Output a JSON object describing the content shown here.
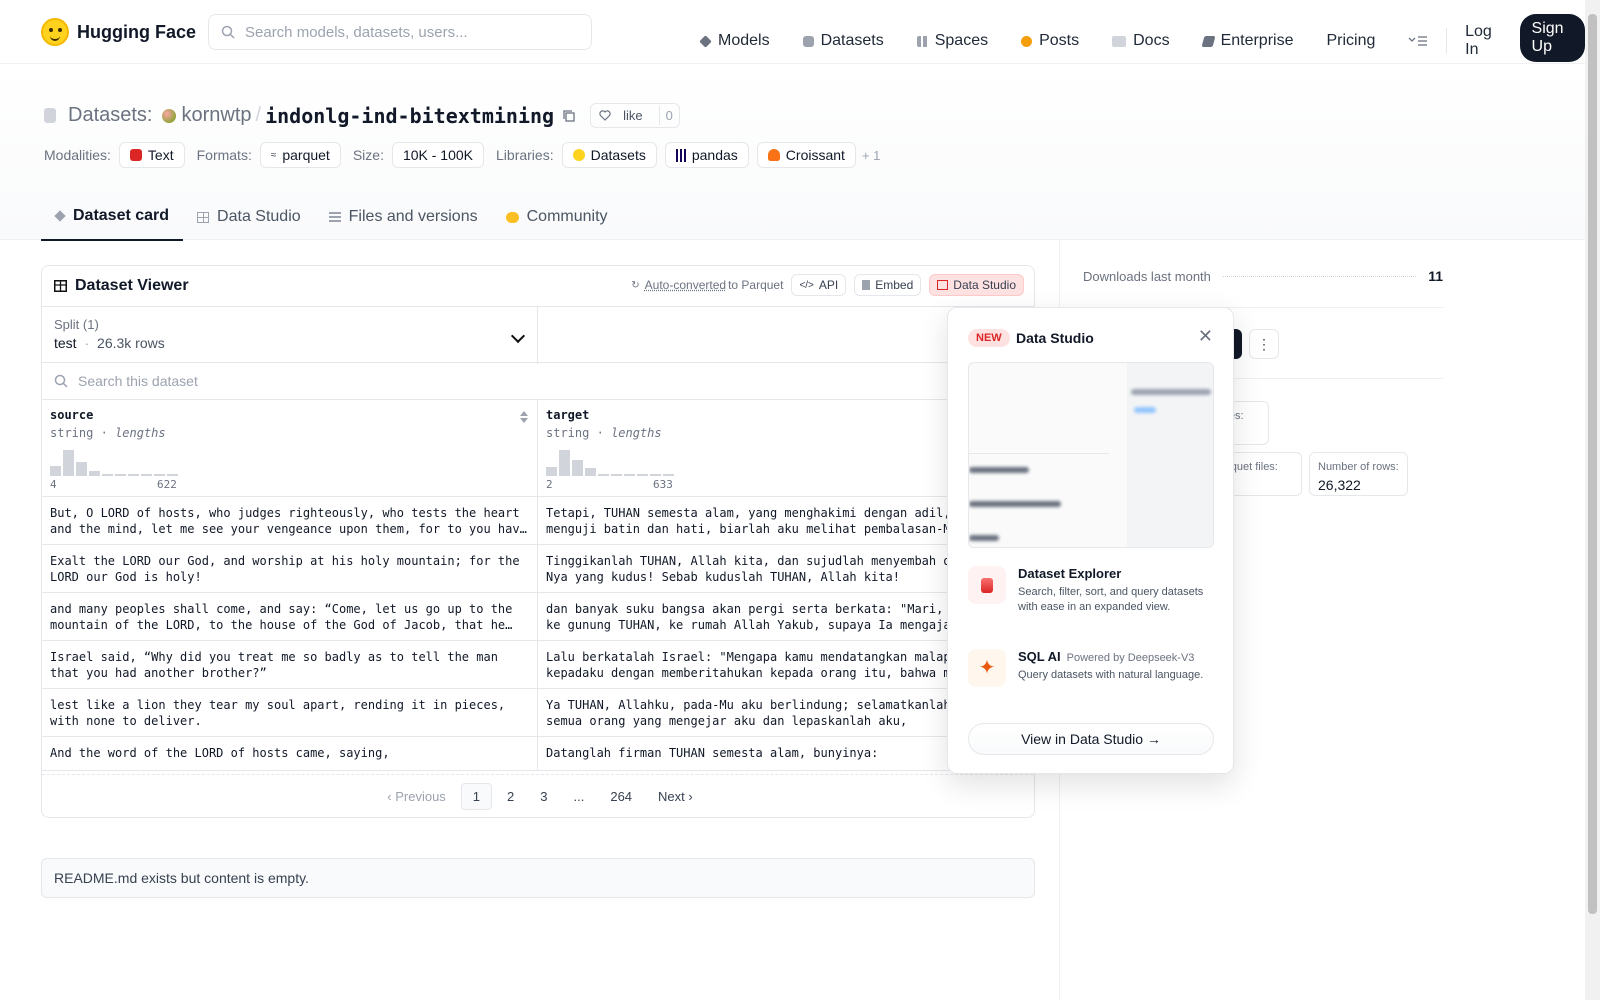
{
  "header": {
    "logo_text": "Hugging Face",
    "search_placeholder": "Search models, datasets, users...",
    "nav": [
      {
        "label": "Models",
        "icon": "cube-icon",
        "color": "#6b7280"
      },
      {
        "label": "Datasets",
        "icon": "database-icon",
        "color": "#9ca3af"
      },
      {
        "label": "Spaces",
        "icon": "grid-icon",
        "color": "#9ca3af"
      },
      {
        "label": "Posts",
        "icon": "chat-icon",
        "color": "#f59e0b"
      },
      {
        "label": "Docs",
        "icon": "book-icon",
        "color": "#9ca3af"
      },
      {
        "label": "Enterprise",
        "icon": "enterprise-icon",
        "color": "#6b7280"
      },
      {
        "label": "Pricing",
        "icon": "",
        "color": ""
      }
    ],
    "login": "Log In",
    "signup": "Sign Up"
  },
  "dataset": {
    "prefix": "Datasets:",
    "owner": "kornwtp",
    "slash": "/",
    "name": "indonlg-ind-bitextmining",
    "like_label": "like",
    "like_count": "0",
    "modalities_label": "Modalities:",
    "modality": "Text",
    "formats_label": "Formats:",
    "format": "parquet",
    "size_label": "Size:",
    "size": "10K - 100K",
    "libraries_label": "Libraries:",
    "libraries": [
      "Datasets",
      "pandas",
      "Croissant"
    ],
    "more_libs": "+ 1"
  },
  "tabs": [
    "Dataset card",
    "Data Studio",
    "Files and versions",
    "Community"
  ],
  "viewer": {
    "title": "Dataset Viewer",
    "auto_converted": "Auto-converted",
    "to_parquet": "to Parquet",
    "api": "API",
    "embed": "Embed",
    "data_studio": "Data Studio",
    "split_label": "Split (1)",
    "split_value": "test",
    "split_dot": "·",
    "split_rows": "26.3k rows",
    "search_placeholder": "Search this dataset",
    "columns": [
      {
        "name": "source",
        "type": "string",
        "dot": "·",
        "sub": "lengths",
        "min": "4",
        "max": "622",
        "hist": [
          0.4,
          1.0,
          0.55,
          0.2,
          0.05,
          0.05,
          0.05,
          0.05,
          0.05,
          0.05
        ]
      },
      {
        "name": "target",
        "type": "string",
        "dot": "·",
        "sub": "lengths",
        "min": "2",
        "max": "633",
        "hist": [
          0.35,
          1.0,
          0.6,
          0.3,
          0.08,
          0.05,
          0.05,
          0.05,
          0.05,
          0.05
        ]
      }
    ],
    "rows": [
      [
        "But, O LORD of hosts, who judges righteously, who tests the heart and the mind, let me see your vengeance upon them, for to you have I committed my cause.",
        "Tetapi, TUHAN semesta alam, yang menghakimi dengan adil, yang menguji batin dan hati, biarlah aku melihat pembalasan-Mu terhadap mereka"
      ],
      [
        "Exalt the LORD our God, and worship at his holy mountain; for the LORD our God is holy!",
        "Tinggikanlah TUHAN, Allah kita, dan sujudlah menyembah di gunung-Nya yang kudus! Sebab kuduslah TUHAN, Allah kita!"
      ],
      [
        "and many peoples shall come, and say: “Come, let us go up to the mountain of the LORD, to the house of the God of Jacob, that he may teach us his ways",
        "dan banyak suku bangsa akan pergi serta berkata: \"Mari, kita naik ke gunung TUHAN, ke rumah Allah Yakub, supaya Ia mengajar kita"
      ],
      [
        "Israel said, “Why did you treat me so badly as to tell the man that you had another brother?”",
        "Lalu berkatalah Israel: \"Mengapa kamu mendatangkan malapetaka kepadaku dengan memberitahukan kepada orang itu, bahwa masih ada adikmu?\""
      ],
      [
        "lest like a lion they tear my soul apart, rending it in pieces, with none to deliver.",
        "Ya TUHAN, Allahku, pada-Mu aku berlindung; selamatkanlah aku dari semua orang yang mengejar aku dan lepaskanlah aku,"
      ],
      [
        "And the word of the LORD of hosts came, saying,",
        "Datanglah firman TUHAN semesta alam, bunyinya:"
      ]
    ],
    "pager": {
      "prev": "Previous",
      "pages": [
        "1",
        "2",
        "3",
        "...",
        "264"
      ],
      "next": "Next"
    }
  },
  "readme": "README.md exists but content is empty.",
  "sidebar": {
    "downloads_label": "Downloads last month",
    "downloads": "11",
    "files_label": "files:",
    "parquet_label": "arquet files:",
    "rows_label": "Number of rows:",
    "rows": "26,322"
  },
  "popover": {
    "badge": "NEW",
    "title": "Data Studio",
    "close": "✕",
    "features": [
      {
        "title": "Dataset Explorer",
        "note": "",
        "desc": "Search, filter, sort, and query datasets with ease in an expanded view.",
        "icon": "database-icon"
      },
      {
        "title": "SQL AI",
        "note": "Powered by Deepseek-V3",
        "desc": "Query datasets with natural language.",
        "icon": "sparkle-icon"
      }
    ],
    "cta": "View in Data Studio →"
  },
  "colors": {
    "accent": "#111827",
    "red": "#dc2626",
    "yellow": "#ffd21e"
  }
}
